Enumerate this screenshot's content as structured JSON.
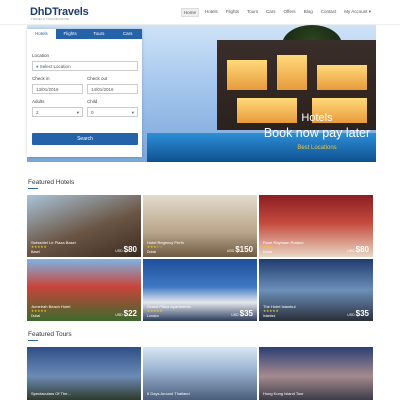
{
  "brand": {
    "name": "DhDTravels",
    "tagline": "TRAVEL & TOUR BOOKING"
  },
  "nav": [
    "Home",
    "Hotels",
    "Flights",
    "Tours",
    "Cars",
    "Offers",
    "Blog",
    "Contact",
    "My Account ▾"
  ],
  "hero": {
    "title": "Hotels",
    "subtitle": "Book now pay later",
    "location": "Best Locations"
  },
  "search": {
    "tabs": [
      "Hotels",
      "Flights",
      "Tours",
      "Cars"
    ],
    "location_label": "Location",
    "location_placeholder": "Select Location",
    "checkin_label": "Check in",
    "checkin_value": "13/01/2016",
    "checkout_label": "Check out",
    "checkout_value": "14/01/2016",
    "adults_label": "Adults",
    "adults_value": "2",
    "child_label": "Child",
    "child_value": "0",
    "button": "Search"
  },
  "featured_hotels_title": "Featured Hotels",
  "hotels": [
    {
      "name": "Swissôtel Le Plaza Basel",
      "loc": "Basel",
      "cur": "USD",
      "price": "$80"
    },
    {
      "name": "Hotel Regency Perth",
      "loc": "Dubai",
      "cur": "USD",
      "price": "$150"
    },
    {
      "name": "Rose Rayhaan Rotana",
      "loc": "Dubai",
      "cur": "USD",
      "price": "$80"
    },
    {
      "name": "Jumeirah Beach Hotel",
      "loc": "Dubai",
      "cur": "USD",
      "price": "$22"
    },
    {
      "name": "Grand Plaza Apartments",
      "loc": "London",
      "cur": "USD",
      "price": "$35"
    },
    {
      "name": "The Hotel Istanbul",
      "loc": "Istanbul",
      "cur": "USD",
      "price": "$35"
    }
  ],
  "featured_tours_title": "Featured Tours",
  "tours": [
    "Spectaculars Of The...",
    "6 Days Around Thailand",
    "Hong Kong Island Tour"
  ],
  "colors": {
    "accent": "#2563a8",
    "stars": "#f4c430",
    "hero_sub": "#f0c53a"
  }
}
